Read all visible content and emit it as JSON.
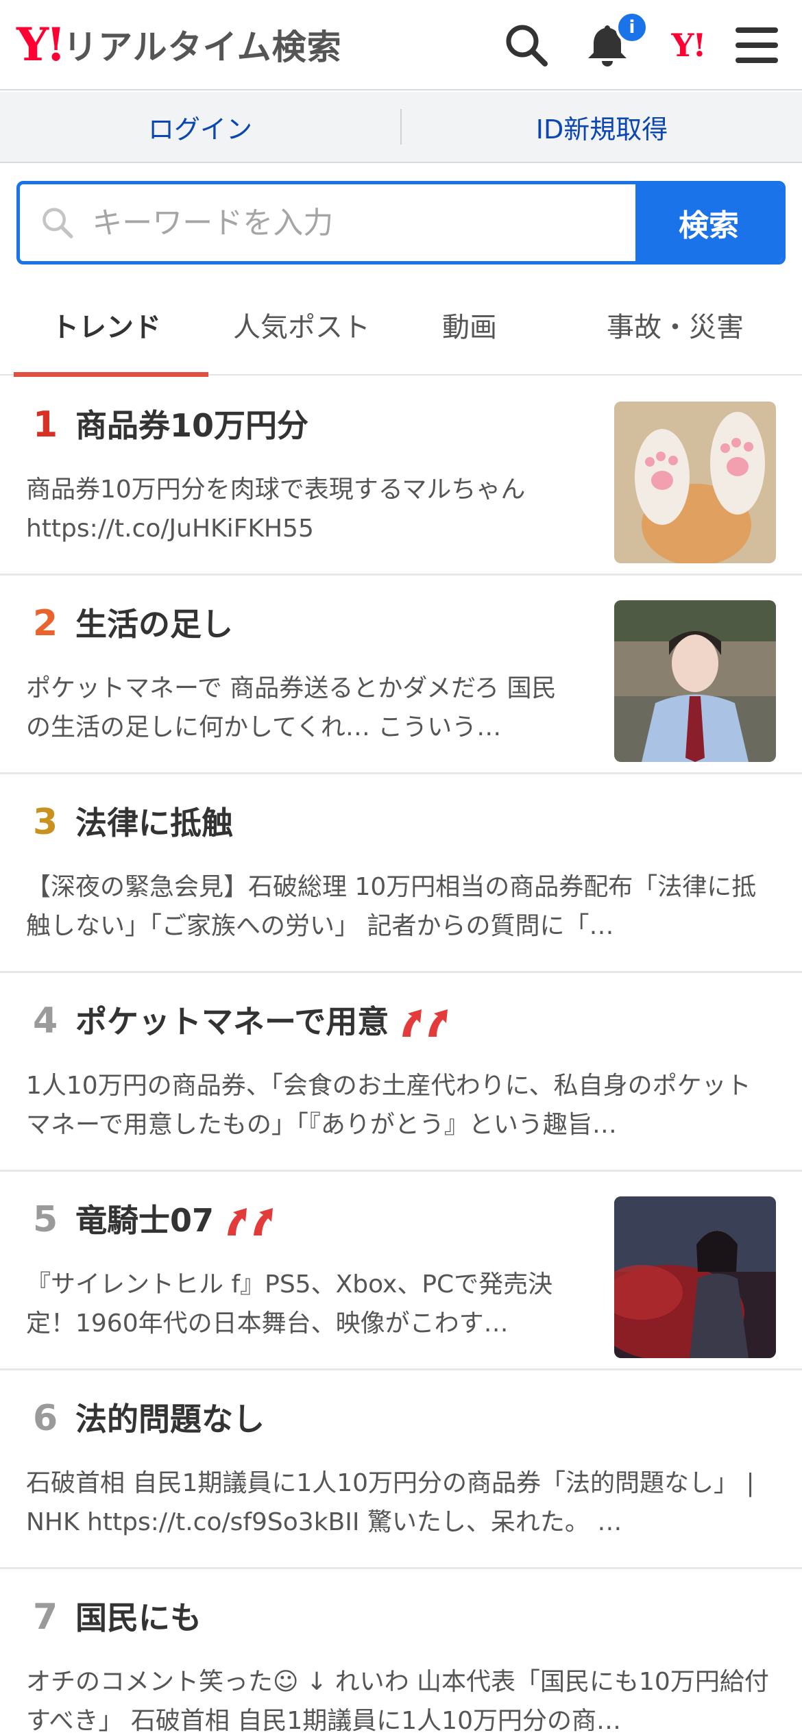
{
  "header": {
    "logo_mark": "Y!",
    "logo_text": "リアルタイム検索",
    "notification_count": "i",
    "yahoo_mark": "Y!"
  },
  "account": {
    "login_label": "ログイン",
    "signup_label": "ID新規取得"
  },
  "search": {
    "placeholder": "キーワードを入力",
    "button_label": "検索"
  },
  "tabs": [
    {
      "label": "トレンド",
      "active": true
    },
    {
      "label": "人気ポスト"
    },
    {
      "label": "動画"
    },
    {
      "label": "事故・災害"
    }
  ],
  "colors": {
    "accent": "#1a73e8",
    "brand": "#ff0033",
    "rank1": "#d93025",
    "rank2": "#e8642c",
    "rank3": "#c9921e",
    "rank_other": "#9a9a9a",
    "up_arrow": "#e33a3a"
  },
  "trends": [
    {
      "rank": "1",
      "title": "商品券10万円分",
      "desc": "商品券10万円分を肉球で表現するマルちゃん https://t.co/JuHKiFKH55",
      "thumbnail": "cat-paws-photo"
    },
    {
      "rank": "2",
      "title": "生活の足し",
      "desc": "ポケットマネーで 商品券送るとかダメだろ 国民の生活の足しに何かしてくれ… こういう…",
      "thumbnail": "uniform-woman-photo"
    },
    {
      "rank": "3",
      "title": "法律に抵触",
      "desc": "【深夜の緊急会見】石破総理 10万円相当の商品券配布「法律に抵触しない」「ご家族への労い」 記者からの質問に「…"
    },
    {
      "rank": "4",
      "title": "ポケットマネーで用意",
      "desc": "1人10万円の商品券、「会食のお土産代わりに、私自身のポケットマネーで用意したもの」「『ありがとう』という趣旨…",
      "rising": true
    },
    {
      "rank": "5",
      "title": "竜騎士07",
      "desc": "『サイレントヒル f』PS5、Xbox、PCで発売決定！1960年代の日本舞台、映像がこわす…",
      "rising": true,
      "thumbnail": "game-scene-photo"
    },
    {
      "rank": "6",
      "title": "法的問題なし",
      "desc": "石破首相 自民1期議員に1人10万円分の商品券「法的問題なし」 | NHK https://t.co/sf9So3kBII 驚いたし、呆れた。 …"
    },
    {
      "rank": "7",
      "title": "国民にも",
      "desc": "オチのコメント笑った☺ ↓ れいわ 山本代表「国民にも10万円給付すべき」 石破首相 自民1期議員に1人10万円分の商…"
    }
  ]
}
